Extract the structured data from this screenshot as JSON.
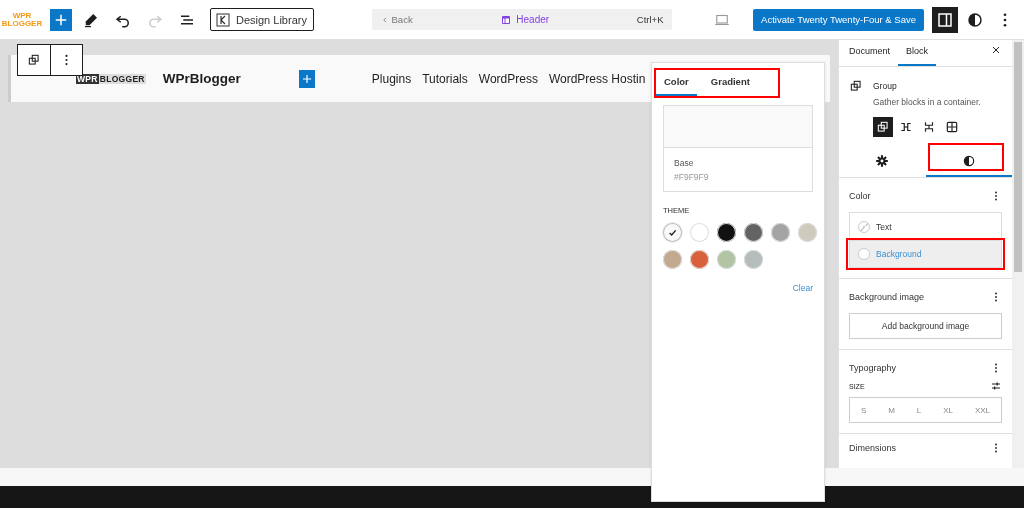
{
  "top_bar": {
    "logo": [
      "WPR",
      "BLOGGER"
    ],
    "design_library": "Design Library",
    "command": {
      "back": "Back",
      "title": "Header",
      "shortcut": "Ctrl+K"
    },
    "save_button": "Activate Twenty Twenty-Four & Save",
    "settings_toggle": {
      "on": true
    }
  },
  "canvas": {
    "header": {
      "logo": [
        "WPR",
        "BLOGGER"
      ],
      "site_title": "WPrBlogger",
      "nav": [
        "Plugins",
        "Tutorials",
        "WordPress",
        "WordPress Hostin"
      ]
    }
  },
  "color_popover": {
    "tabs": [
      {
        "label": "Color",
        "selected": true
      },
      {
        "label": "Gradient",
        "selected": false
      }
    ],
    "preview": {
      "name": "Base",
      "value": "#F9F9F9",
      "color": "#f9f9f9"
    },
    "theme_label": "THEME",
    "swatches": [
      {
        "color": "#f9f9f9",
        "selected": true
      },
      {
        "color": "#ffffff",
        "selected": false
      },
      {
        "color": "#111111",
        "selected": false
      },
      {
        "color": "#636363",
        "selected": false
      },
      {
        "color": "#a4a4a4",
        "selected": false
      },
      {
        "color": "#cfcabe",
        "selected": false
      },
      {
        "color": "#c2a990",
        "selected": false
      },
      {
        "color": "#d8613c",
        "selected": false
      },
      {
        "color": "#b1c5a4",
        "selected": false
      },
      {
        "color": "#b5bdbc",
        "selected": false
      }
    ],
    "clear": "Clear"
  },
  "sidebar": {
    "tabs": [
      {
        "label": "Document",
        "selected": false
      },
      {
        "label": "Block",
        "selected": true
      }
    ],
    "block": {
      "title": "Group",
      "description": "Gather blocks in a container.",
      "variations": [
        {
          "kind": "group",
          "selected": true
        },
        {
          "kind": "row",
          "selected": false
        },
        {
          "kind": "stack",
          "selected": false
        },
        {
          "kind": "grid",
          "selected": false
        }
      ]
    },
    "inspector_tabs": [
      {
        "kind": "settings",
        "selected": false
      },
      {
        "kind": "styles",
        "selected": true
      }
    ],
    "color": {
      "title": "Color",
      "items": [
        {
          "label": "Text",
          "selected": false
        },
        {
          "label": "Background",
          "selected": true
        }
      ]
    },
    "background_image": {
      "title": "Background image",
      "button": "Add background image"
    },
    "typography": {
      "title": "Typography",
      "size_label": "SIZE",
      "sizes": [
        "S",
        "M",
        "L",
        "XL",
        "XXL"
      ]
    },
    "dimensions": {
      "title": "Dimensions"
    }
  }
}
